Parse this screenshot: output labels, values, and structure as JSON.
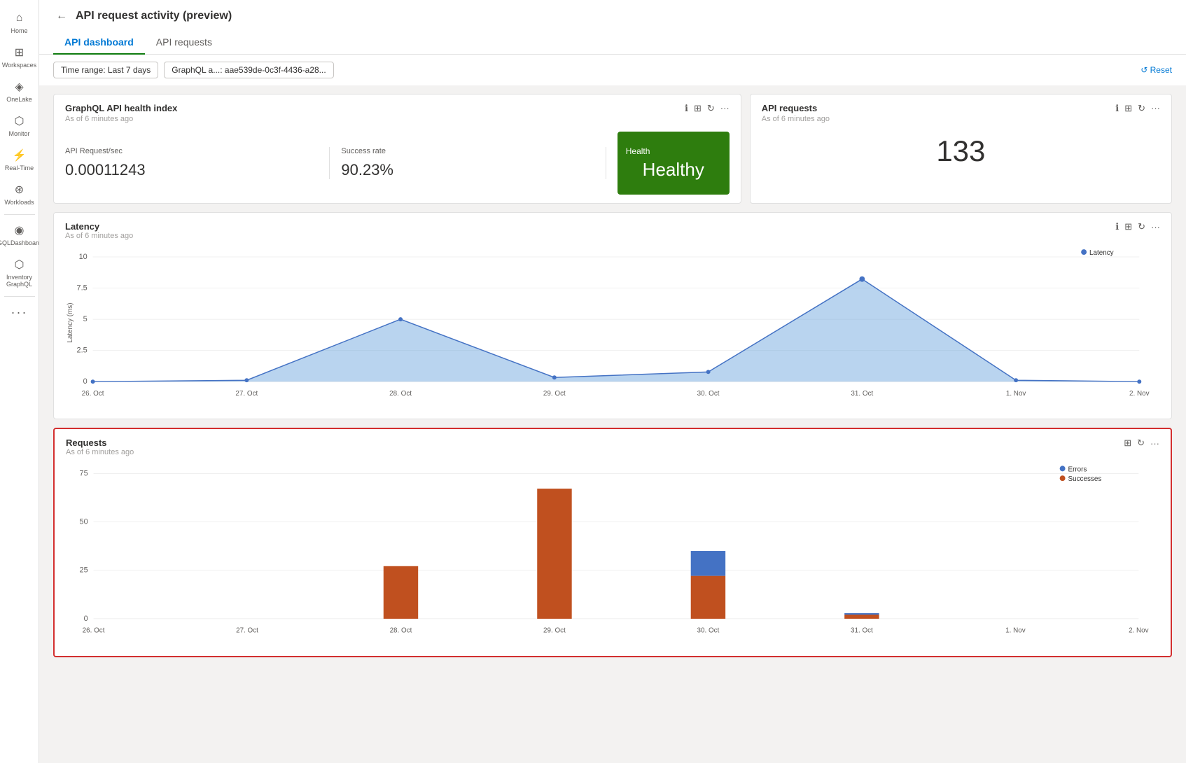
{
  "sidebar": {
    "items": [
      {
        "id": "home",
        "label": "Home",
        "icon": "⌂"
      },
      {
        "id": "workspaces",
        "label": "Workspaces",
        "icon": "⊞"
      },
      {
        "id": "onelake",
        "label": "OneLake",
        "icon": "◈"
      },
      {
        "id": "monitor",
        "label": "Monitor",
        "icon": "⬡"
      },
      {
        "id": "realtime",
        "label": "Real-Time",
        "icon": "⚡"
      },
      {
        "id": "workloads",
        "label": "Workloads",
        "icon": "⊛"
      },
      {
        "id": "gql-dashboard",
        "label": "GQLDashboard",
        "icon": "◉"
      },
      {
        "id": "inventory-graphql",
        "label": "Inventory GraphQL",
        "icon": "⬡"
      }
    ],
    "more_label": "..."
  },
  "header": {
    "back_label": "←",
    "title": "API request activity (preview)",
    "tabs": [
      {
        "id": "api-dashboard",
        "label": "API dashboard",
        "active": true
      },
      {
        "id": "api-requests",
        "label": "API requests",
        "active": false
      }
    ]
  },
  "toolbar": {
    "filters": [
      {
        "id": "time-range",
        "label": "Time range: Last 7 days"
      },
      {
        "id": "graphql-api",
        "label": "GraphQL a...: aae539de-0c3f-4436-a28..."
      }
    ],
    "reset_label": "↺ Reset"
  },
  "graphql_health_card": {
    "title": "GraphQL API health index",
    "subtitle": "As of 6 minutes ago",
    "metrics": [
      {
        "label": "API Request/sec",
        "value": "0.00011243"
      },
      {
        "label": "Success rate",
        "value": "90.23%"
      }
    ],
    "health": {
      "label": "Health",
      "status": "Healthy",
      "color": "#2e7d0e"
    }
  },
  "api_requests_card": {
    "title": "API requests",
    "subtitle": "As of 6 minutes ago",
    "value": "133"
  },
  "latency_chart": {
    "title": "Latency",
    "subtitle": "As of 6 minutes ago",
    "y_label": "Latency (ms)",
    "legend": "Latency",
    "y_ticks": [
      "10",
      "7.5",
      "5",
      "2.5",
      "0"
    ],
    "x_labels": [
      "26. Oct",
      "27. Oct",
      "28. Oct",
      "29. Oct",
      "30. Oct",
      "31. Oct",
      "1. Nov",
      "2. Nov"
    ],
    "data_points": [
      {
        "x": "26. Oct",
        "y": 0
      },
      {
        "x": "27. Oct",
        "y": 0.1
      },
      {
        "x": "28. Oct",
        "y": 5.2
      },
      {
        "x": "29. Oct",
        "y": 0.3
      },
      {
        "x": "30. Oct",
        "y": 0.8
      },
      {
        "x": "31. Oct",
        "y": 8.2
      },
      {
        "x": "1. Nov",
        "y": 0.1
      },
      {
        "x": "2. Nov",
        "y": 0
      }
    ]
  },
  "requests_chart": {
    "title": "Requests",
    "subtitle": "As of 6 minutes ago",
    "highlighted": true,
    "legend": [
      {
        "label": "Errors",
        "color": "#4472c4"
      },
      {
        "label": "Successes",
        "color": "#c0501f"
      }
    ],
    "y_ticks": [
      "75",
      "50",
      "25",
      "0"
    ],
    "x_labels": [
      "26. Oct",
      "27. Oct",
      "28. Oct",
      "29. Oct",
      "30. Oct",
      "31. Oct",
      "1. Nov",
      "2. Nov"
    ],
    "data": [
      {
        "x": "26. Oct",
        "successes": 0,
        "errors": 0
      },
      {
        "x": "27. Oct",
        "successes": 0,
        "errors": 0
      },
      {
        "x": "28. Oct",
        "successes": 27,
        "errors": 0
      },
      {
        "x": "29. Oct",
        "successes": 67,
        "errors": 0
      },
      {
        "x": "30. Oct",
        "successes": 22,
        "errors": 13
      },
      {
        "x": "31. Oct",
        "successes": 2,
        "errors": 0.5
      },
      {
        "x": "1. Nov",
        "successes": 0,
        "errors": 0
      },
      {
        "x": "2. Nov",
        "successes": 0,
        "errors": 0
      }
    ]
  }
}
